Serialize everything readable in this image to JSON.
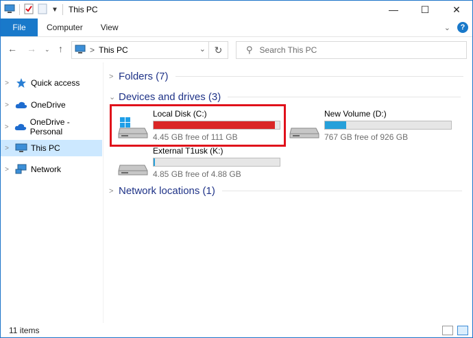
{
  "window": {
    "title": "This PC"
  },
  "window_controls": {
    "minimize": "—",
    "maximize": "☐",
    "close": "✕"
  },
  "ribbon": {
    "tabs": [
      {
        "label": "File"
      },
      {
        "label": "Computer"
      },
      {
        "label": "View"
      }
    ]
  },
  "address": {
    "separator": ">",
    "location": "This PC"
  },
  "search": {
    "placeholder": "Search This PC"
  },
  "sidebar": {
    "items": [
      {
        "label": "Quick access",
        "icon": "star-icon"
      },
      {
        "label": "OneDrive",
        "icon": "cloud-icon"
      },
      {
        "label": "OneDrive - Personal",
        "icon": "cloud-icon"
      },
      {
        "label": "This PC",
        "icon": "computer-icon",
        "selected": true
      },
      {
        "label": "Network",
        "icon": "network-icon"
      }
    ]
  },
  "groups": {
    "folders": "Folders (7)",
    "devices": "Devices and drives (3)",
    "network": "Network locations (1)"
  },
  "drives": [
    {
      "name": "Local Disk (C:)",
      "free": "4.45 GB free of 111 GB",
      "used_fraction": 0.96,
      "color": "#da2626"
    },
    {
      "name": "New Volume (D:)",
      "free": "767 GB free of 926 GB",
      "used_fraction": 0.17,
      "color": "#26a0da"
    },
    {
      "name": "External T1usk (K:)",
      "free": "4.85 GB free of 4.88 GB",
      "used_fraction": 0.01,
      "color": "#26a0da"
    }
  ],
  "status": {
    "items": "11 items"
  },
  "colors": {
    "accent": "#1979ca",
    "selection": "#cce8ff",
    "highlight_box": "#e0101a"
  }
}
